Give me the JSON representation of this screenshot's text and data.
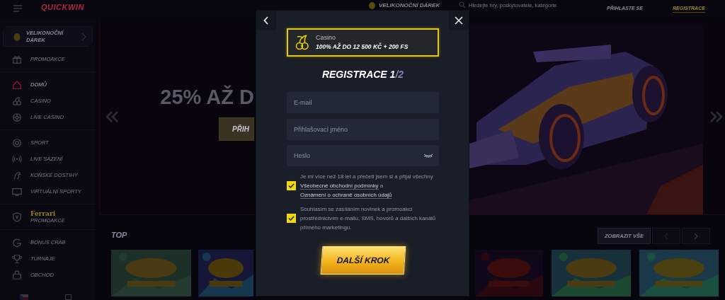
{
  "header": {
    "logo": "QUICKWIN",
    "promo": "VELIKONOČNÍ DÁREK",
    "search": {
      "placeholder": "Hledejte hry, poskytovatele, kategorie"
    },
    "login": "PŘIHLASTE SE",
    "register": "REGISTRACE"
  },
  "sidebar": {
    "promo_card": {
      "label": "VELIKONOČNÍ DÁREK"
    },
    "groups": [
      [
        {
          "kind": "link",
          "label": "PROMOAKCE",
          "selected": false
        }
      ],
      [
        {
          "kind": "link",
          "label": "DOMŮ",
          "selected": true
        },
        {
          "kind": "link",
          "label": "CASINO",
          "selected": false
        },
        {
          "kind": "link",
          "label": "LIVE CASINO",
          "selected": false
        }
      ],
      [
        {
          "kind": "link",
          "label": "SPORT",
          "selected": false
        },
        {
          "kind": "link",
          "label": "LIVE SÁZENÍ",
          "selected": false
        },
        {
          "kind": "link",
          "label": "KOŇSKÉ DOSTIHY",
          "selected": false
        },
        {
          "kind": "link",
          "label": "VIRTUÁLNÍ SPORTY",
          "selected": false
        }
      ],
      [
        {
          "kind": "brand",
          "logo": "Ferrari",
          "label": "PROMOAKCE",
          "selected": false
        }
      ],
      [
        {
          "kind": "link",
          "label": "BONUS CRAB",
          "selected": false
        },
        {
          "kind": "link",
          "label": "TURNAJE",
          "selected": false
        },
        {
          "kind": "link",
          "label": "OBCHOD",
          "selected": false
        }
      ]
    ]
  },
  "banner": {
    "headline": "25% AŽ D",
    "button": "PŘIH"
  },
  "games": {
    "title": "TOP",
    "view_all": "ZOBRAZIT VŠE"
  },
  "modal": {
    "bonus": {
      "category": "Casino",
      "offer": "100% AŽ DO 12 500 KČ + 200 FS"
    },
    "title": "REGISTRACE 1",
    "title_suffix": "/2",
    "fields": [
      {
        "kind": "text",
        "placeholder": "E-mail"
      },
      {
        "kind": "text",
        "placeholder": "Přihlašovací jméno"
      },
      {
        "kind": "password",
        "placeholder": "Heslo"
      }
    ],
    "consents": [
      {
        "checked": true,
        "parts": [
          {
            "kind": "text",
            "text": "Je mi více než 18 let a přečetl jsem si a přijal všechny "
          },
          {
            "kind": "link",
            "text": "Všeobecné obchodní podmínky"
          },
          {
            "kind": "text",
            "text": " a "
          },
          {
            "kind": "link",
            "text": "Oznámení o ochraně osobních údajů"
          }
        ]
      },
      {
        "checked": true,
        "parts": [
          {
            "kind": "text",
            "text": "Souhlasím se zasíláním novinek a promoakcí prostřednictvím e-mailu, SMS, hovorů a dalších kanálů přímého marketingu."
          }
        ]
      }
    ],
    "button": "DALŠÍ KROK"
  }
}
